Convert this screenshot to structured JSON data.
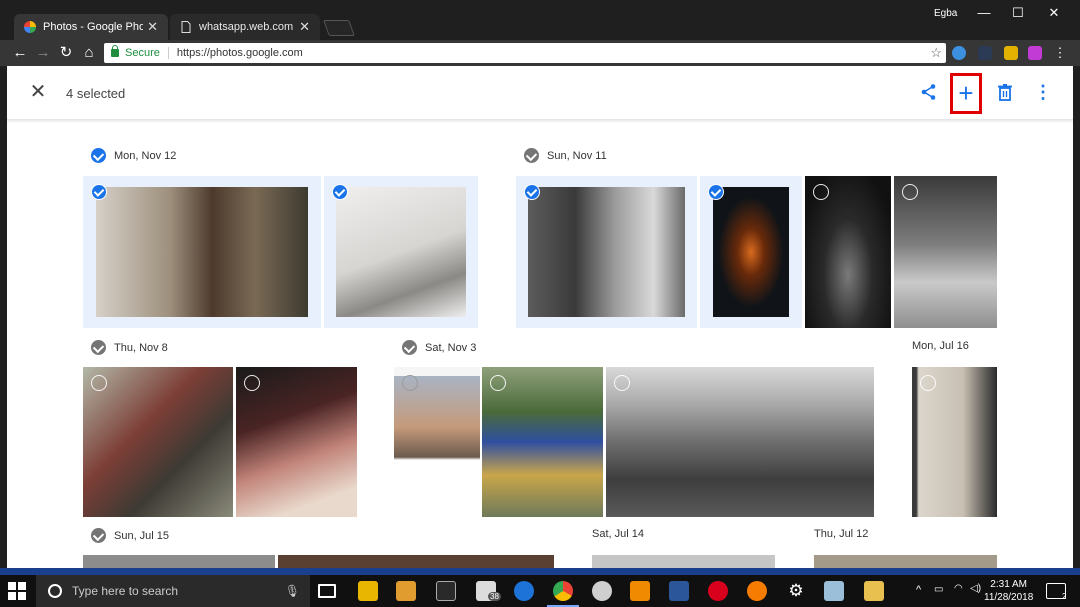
{
  "browser": {
    "tabs": [
      {
        "title": "Photos - Google Photos",
        "close": "✕"
      },
      {
        "title": "whatsapp.web.com",
        "close": "✕"
      }
    ],
    "profile": "Egba",
    "window_controls": {
      "minimize": "—",
      "maximize": "☐",
      "close": "✕"
    },
    "secure_label": "Secure",
    "url": "https://photos.google.com"
  },
  "selection_bar": {
    "count_label": "4 selected",
    "close_icon": "✕",
    "share_icon": "share-icon",
    "add_icon": "+",
    "delete_icon": "trash-icon",
    "more_icon": "⋮"
  },
  "dates": {
    "mon_nov_12": "Mon, Nov 12",
    "sun_nov_11": "Sun, Nov 11",
    "thu_nov_8": "Thu, Nov 8",
    "sat_nov_3": "Sat, Nov 3",
    "mon_jul_16": "Mon, Jul 16",
    "sun_jul_15": "Sun, Jul 15",
    "sat_jul_14": "Sat, Jul 14",
    "thu_jul_12": "Thu, Jul 12"
  },
  "taskbar": {
    "search_placeholder": "Type here to search",
    "mail_badge": "38",
    "time": "2:31 AM",
    "date": "11/28/2018",
    "notification_count": "2"
  },
  "colors": {
    "accent": "#1a73e8",
    "highlight": "#e00000",
    "selected_bg": "#e8f0fe"
  }
}
